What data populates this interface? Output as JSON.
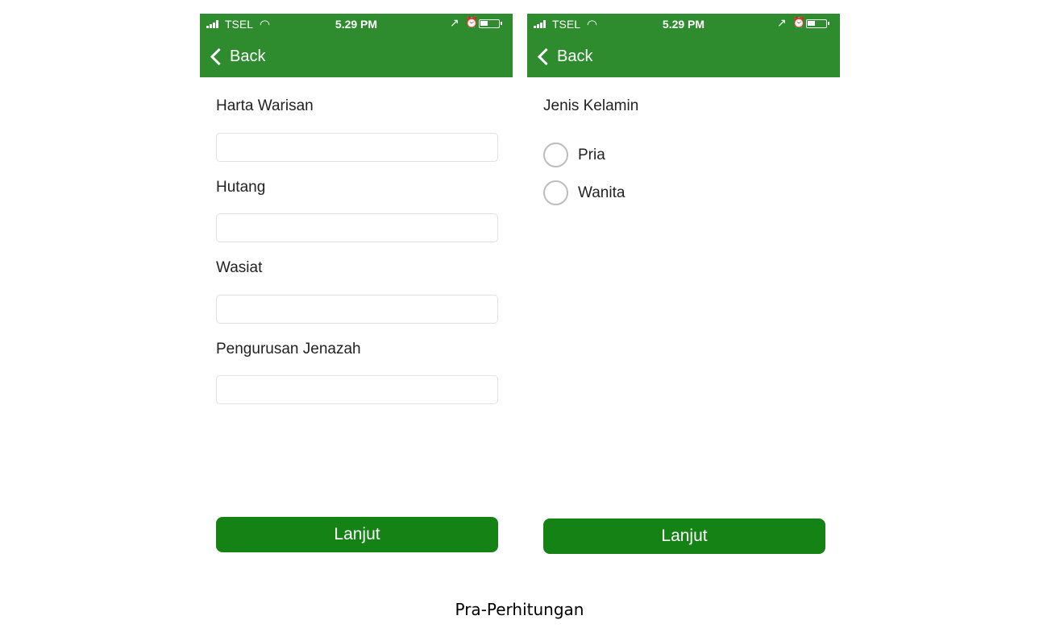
{
  "status_bar": {
    "carrier": "TSEL",
    "time": "5.29 PM",
    "icons": [
      "signal-bars-icon",
      "wifi-icon",
      "location-arrow-icon",
      "alarm-icon",
      "battery-icon"
    ]
  },
  "nav": {
    "back_label": "Back"
  },
  "screen_left": {
    "fields": [
      {
        "label": "Harta Warisan",
        "value": "",
        "placeholder": ""
      },
      {
        "label": "Hutang",
        "value": "",
        "placeholder": ""
      },
      {
        "label": "Wasiat",
        "value": "",
        "placeholder": ""
      },
      {
        "label": "Pengurusan Jenazah",
        "value": "",
        "placeholder": ""
      }
    ],
    "button_label": "Lanjut"
  },
  "screen_right": {
    "title": "Jenis Kelamin",
    "options": [
      {
        "label": "Pria",
        "selected": false
      },
      {
        "label": "Wanita",
        "selected": false
      }
    ],
    "button_label": "Lanjut"
  },
  "caption": "Pra-Perhitungan",
  "colors": {
    "header_bg": "#2e8b2e",
    "button_bg": "#148214",
    "radio_border": "#bdbdbd",
    "input_border": "#e2e2e2"
  }
}
